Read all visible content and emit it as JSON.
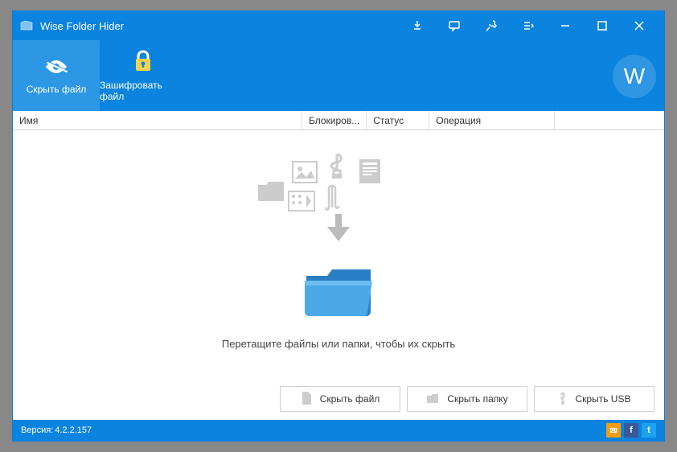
{
  "titlebar": {
    "title": "Wise Folder Hider"
  },
  "toolbar": {
    "tabs": [
      {
        "label": "Скрыть файл"
      },
      {
        "label": "Зашифровать файл"
      }
    ]
  },
  "columns": {
    "name": "Имя",
    "lock": "Блокиров...",
    "status": "Статус",
    "operation": "Операция"
  },
  "drop": {
    "text": "Перетащите файлы или папки, чтобы их скрыть"
  },
  "buttons": {
    "hideFile": "Скрыть файл",
    "hideFolder": "Скрыть папку",
    "hideUsb": "Скрыть USB"
  },
  "statusbar": {
    "version_label": "Версия:",
    "version_value": "4.2.2.157"
  },
  "social": {
    "mail": "✉",
    "fb": "f",
    "tw": "t"
  },
  "wlogo": "W"
}
